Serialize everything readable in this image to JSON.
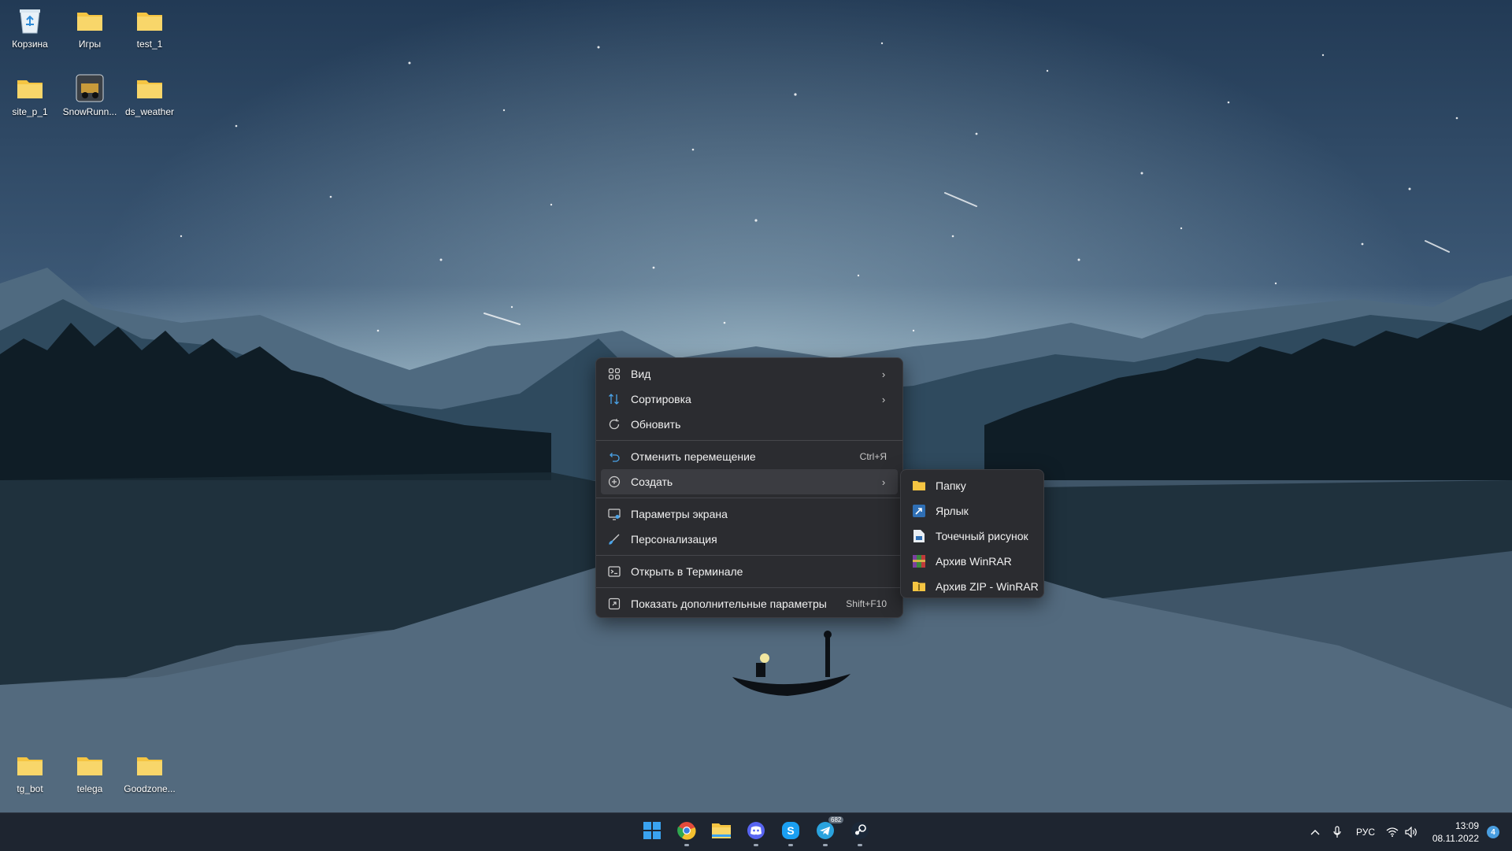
{
  "desktop": {
    "icons_top": [
      {
        "label": "Корзина",
        "icon": "recycle-bin-icon"
      },
      {
        "label": "Игры",
        "icon": "folder-icon"
      },
      {
        "label": "test_1",
        "icon": "folder-icon"
      },
      {
        "label": "site_p_1",
        "icon": "folder-icon"
      },
      {
        "label": "SnowRunn...",
        "icon": "game-icon"
      },
      {
        "label": "ds_weather",
        "icon": "folder-icon"
      }
    ],
    "icons_bottom": [
      {
        "label": "tg_bot",
        "icon": "folder-icon"
      },
      {
        "label": "telega",
        "icon": "folder-icon"
      },
      {
        "label": "Goodzone...",
        "icon": "folder-icon"
      }
    ]
  },
  "context_menu": {
    "items": [
      {
        "label": "Вид",
        "icon": "grid-view-icon",
        "shortcut": "",
        "has_submenu": true
      },
      {
        "label": "Сортировка",
        "icon": "sort-icon",
        "shortcut": "",
        "has_submenu": true
      },
      {
        "label": "Обновить",
        "icon": "refresh-icon",
        "shortcut": "",
        "has_submenu": false
      },
      {
        "label": "Отменить перемещение",
        "icon": "undo-icon",
        "shortcut": "Ctrl+Я",
        "has_submenu": false
      },
      {
        "label": "Создать",
        "icon": "plus-circle-icon",
        "shortcut": "",
        "has_submenu": true
      },
      {
        "label": "Параметры экрана",
        "icon": "display-settings-icon",
        "shortcut": "",
        "has_submenu": false
      },
      {
        "label": "Персонализация",
        "icon": "brush-icon",
        "shortcut": "",
        "has_submenu": false
      },
      {
        "label": "Открыть в Терминале",
        "icon": "terminal-icon",
        "shortcut": "",
        "has_submenu": false
      },
      {
        "label": "Показать дополнительные параметры",
        "icon": "more-options-icon",
        "shortcut": "Shift+F10",
        "has_submenu": false
      }
    ],
    "arrow": "›"
  },
  "submenu": {
    "items": [
      {
        "label": "Папку",
        "icon": "folder-icon"
      },
      {
        "label": "Ярлык",
        "icon": "shortcut-icon"
      },
      {
        "label": "Точечный рисунок",
        "icon": "bitmap-icon"
      },
      {
        "label": "Архив WinRAR",
        "icon": "winrar-icon"
      },
      {
        "label": "Архив ZIP - WinRAR",
        "icon": "zip-archive-icon"
      }
    ]
  },
  "taskbar": {
    "apps": [
      {
        "name": "start",
        "icon": "windows-start-icon"
      },
      {
        "name": "chrome",
        "icon": "chrome-icon"
      },
      {
        "name": "explorer",
        "icon": "file-explorer-icon"
      },
      {
        "name": "discord",
        "icon": "discord-icon"
      },
      {
        "name": "skype",
        "icon": "skype-icon"
      },
      {
        "name": "telegram",
        "icon": "telegram-icon",
        "badge": "682"
      },
      {
        "name": "steam",
        "icon": "steam-icon"
      }
    ],
    "language": "РУС",
    "time": "13:09",
    "date": "08.11.2022",
    "notifications": "4"
  },
  "colors": {
    "menu_bg": "#2b2c30",
    "menu_hover": "#3b3c41",
    "taskbar_bg": "#1e2530",
    "folder_yellow": "#f5c542"
  }
}
